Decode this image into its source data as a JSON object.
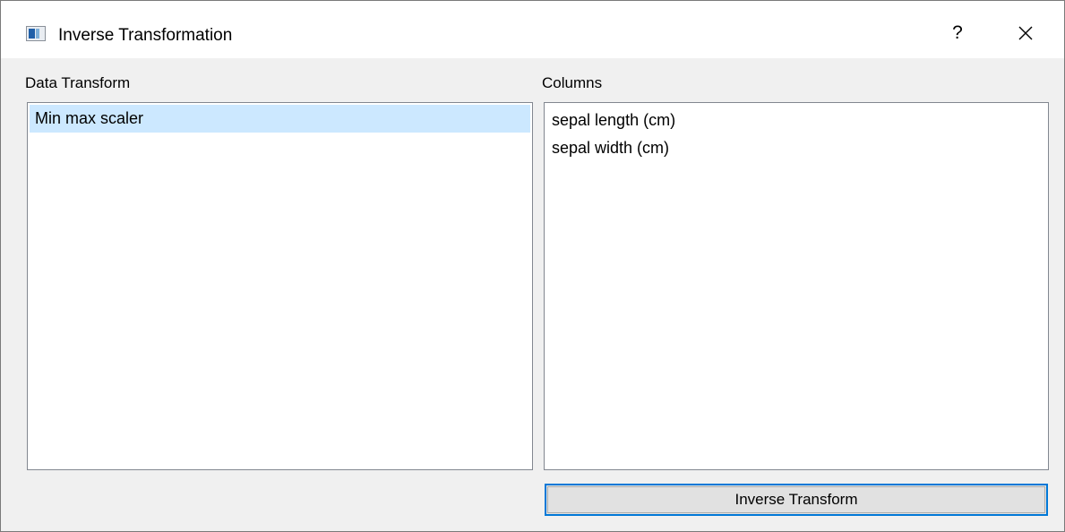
{
  "window": {
    "title": "Inverse Transformation",
    "help_label": "?"
  },
  "transforms": {
    "label": "Data Transform",
    "items": [
      "Min max scaler"
    ],
    "selected_index": 0
  },
  "columns": {
    "label": "Columns",
    "items": [
      "sepal length (cm)",
      "sepal width (cm)"
    ]
  },
  "actions": {
    "inverse_transform_label": "Inverse Transform"
  },
  "colors": {
    "selection": "#cce8ff",
    "focus_border": "#0078d7",
    "button_face": "#e1e1e1"
  },
  "icons": {
    "app": "window-app-icon",
    "close": "close-icon"
  }
}
